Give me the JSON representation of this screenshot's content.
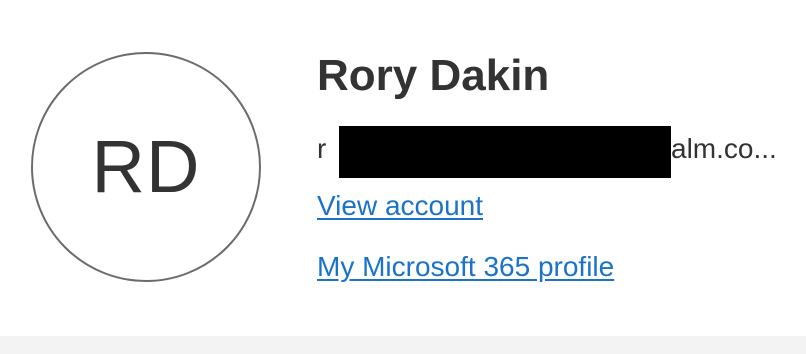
{
  "profile": {
    "initials": "RD",
    "display_name": "Rory Dakin",
    "email_visible_prefix": "r",
    "email_visible_suffix": "alm.co..."
  },
  "links": {
    "view_account": "View account",
    "profile": "My Microsoft 365 profile"
  },
  "colors": {
    "link": "#1a73c9",
    "text": "#333333",
    "avatar_border": "#6b6b6b",
    "footer": "#f3f3f3"
  }
}
